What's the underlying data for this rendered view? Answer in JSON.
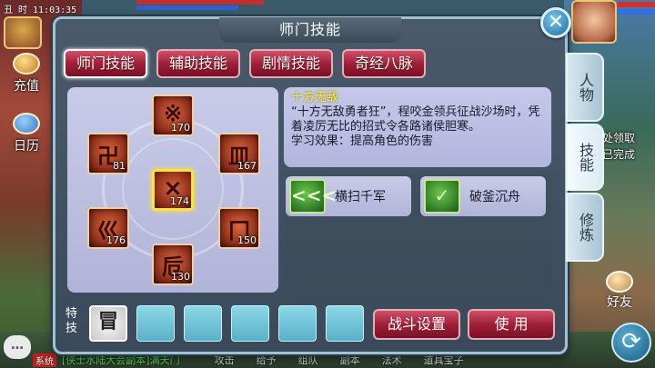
{
  "hud": {
    "time": "丑 时   11:03:35",
    "recharge_label": "充值",
    "calendar_label": "日历",
    "quest_status_line1": "处领取",
    "quest_status_line2": "已完成",
    "friend_label": "好友"
  },
  "bottom_bar": {
    "system_tag": "系统",
    "message": "[侠士水陆大会副本]满天门",
    "menu": [
      "攻击",
      "给予",
      "组队",
      "副本",
      "法术",
      "道具宝子"
    ]
  },
  "dialog": {
    "title": "师门技能",
    "tabs": [
      "师门技能",
      "辅助技能",
      "剧情技能",
      "奇经八脉"
    ],
    "side_tabs": [
      "人物",
      "技能",
      "修炼"
    ],
    "skills": [
      {
        "glyph": "※",
        "level": "170"
      },
      {
        "glyph": "卍",
        "level": "81"
      },
      {
        "glyph": "皿",
        "level": "167"
      },
      {
        "glyph": "✕",
        "level": "174"
      },
      {
        "glyph": "巛",
        "level": "176"
      },
      {
        "glyph": "冂",
        "level": "150"
      },
      {
        "glyph": "卮",
        "level": "130"
      }
    ],
    "description": {
      "title": "十方无敌",
      "body": "“十方无敌勇者狂”，程咬金领兵征战沙场时，凭着凌厉无比的招式令各路诸侯胆寒。",
      "effect": "学习效果：提高角色的伤害"
    },
    "actions": [
      {
        "icon": "<<<",
        "label": "横扫千军"
      },
      {
        "icon": "✓",
        "label": "破釜沉舟"
      }
    ],
    "special_label": "特技",
    "special_slot_glyph": "冒",
    "battle_settings": "战斗设置",
    "use": "使 用"
  }
}
